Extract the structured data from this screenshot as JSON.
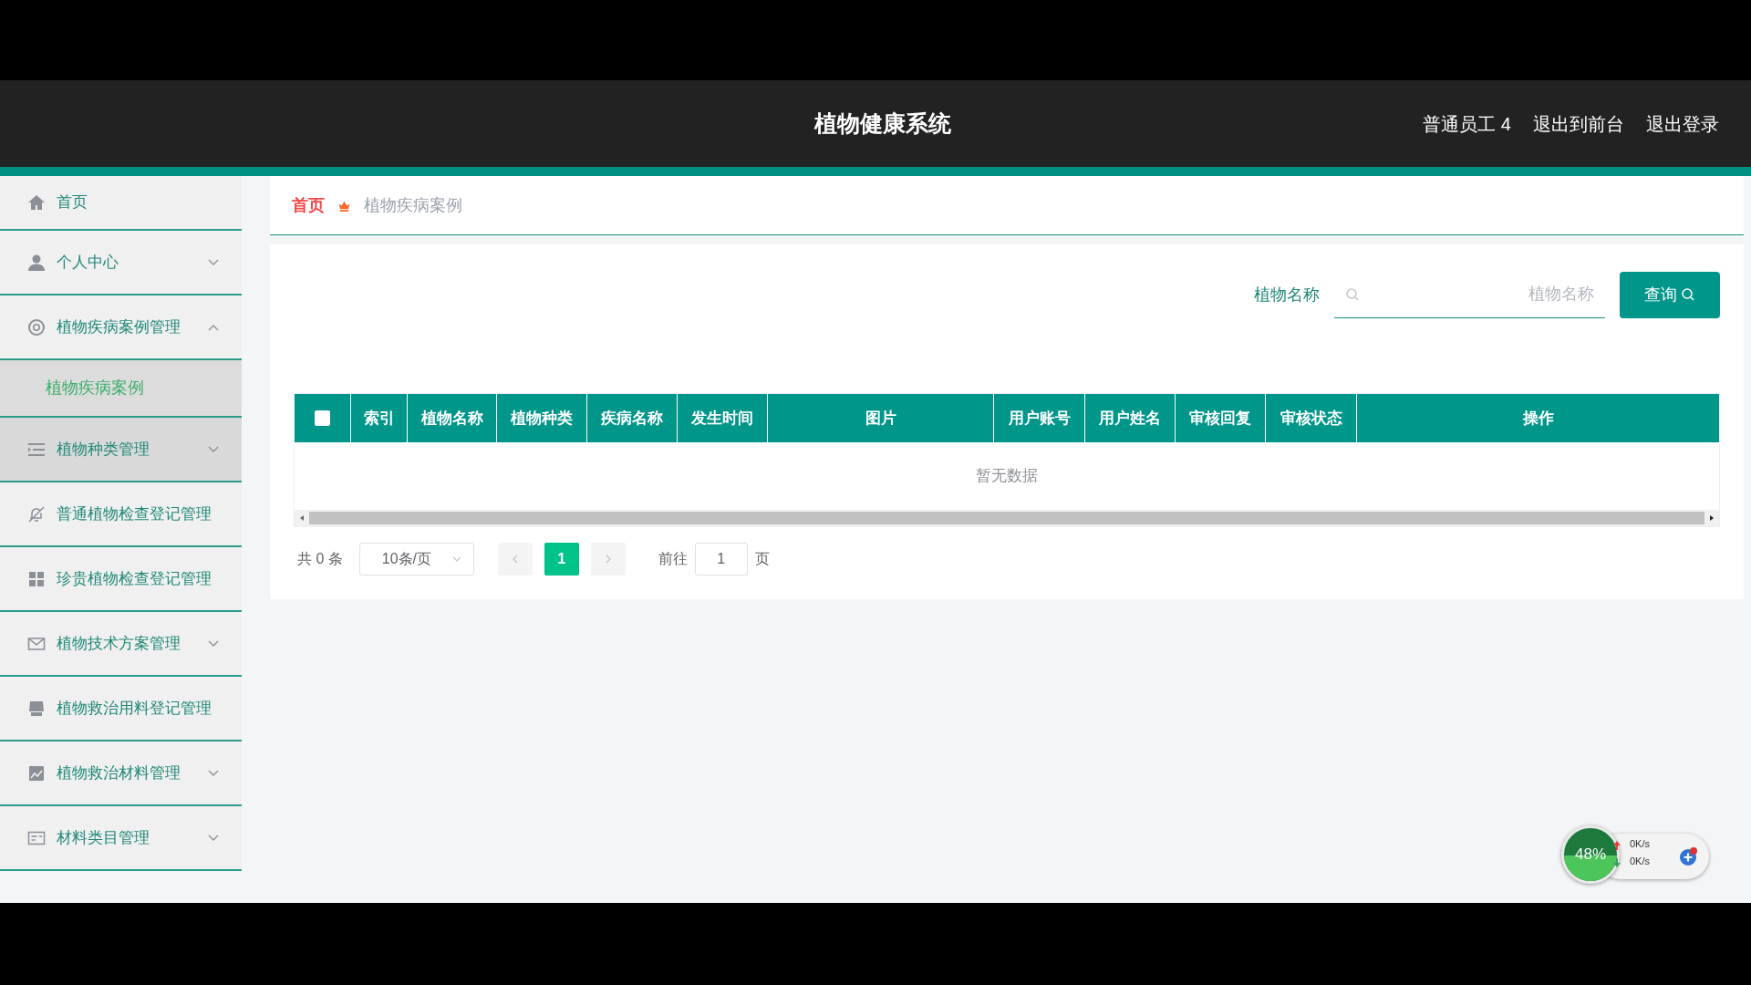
{
  "header": {
    "title": "植物健康系统",
    "user": "普通员工 4",
    "links": [
      "退出到前台",
      "退出登录"
    ]
  },
  "sidebar": {
    "items": [
      {
        "label": "首页",
        "highlighted": false
      },
      {
        "label": "个人中心",
        "highlighted": false,
        "expanded": false
      },
      {
        "label": "植物疾病案例管理",
        "highlighted": false,
        "expanded": true,
        "children": [
          {
            "label": "植物疾病案例",
            "selected": true
          }
        ]
      },
      {
        "label": "植物种类管理",
        "highlighted": true,
        "expanded": false
      },
      {
        "label": "普通植物检查登记管理",
        "highlighted": false
      },
      {
        "label": "珍贵植物检查登记管理",
        "highlighted": false
      },
      {
        "label": "植物技术方案管理",
        "highlighted": false,
        "expanded": false
      },
      {
        "label": "植物救治用料登记管理",
        "highlighted": false
      },
      {
        "label": "植物救治材料管理",
        "highlighted": false,
        "expanded": false
      },
      {
        "label": "材料类目管理",
        "highlighted": false,
        "expanded": false
      }
    ]
  },
  "breadcrumb": [
    "首页",
    "植物疾病案例"
  ],
  "search": {
    "label": "植物名称",
    "placeholder": "植物名称",
    "button": "查询"
  },
  "table": {
    "columns": [
      {
        "kind": "checkbox",
        "checked": false
      },
      {
        "kind": "text",
        "label": "索引"
      },
      {
        "kind": "text",
        "label": "植物名称"
      },
      {
        "kind": "text",
        "label": "植物种类"
      },
      {
        "kind": "text",
        "label": "疾病名称"
      },
      {
        "kind": "text",
        "label": "发生时间"
      },
      {
        "kind": "text",
        "label": "图片"
      },
      {
        "kind": "text",
        "label": "用户账号"
      },
      {
        "kind": "text",
        "label": "用户姓名"
      },
      {
        "kind": "text",
        "label": "审核回复"
      },
      {
        "kind": "text",
        "label": "审核状态"
      },
      {
        "kind": "text",
        "label": "操作"
      }
    ],
    "empty_text": "暂无数据"
  },
  "pagination": {
    "total": "共 0 条",
    "page_size": "10条/页",
    "pages": [
      {
        "label": "1",
        "selected": true
      }
    ],
    "goto_label": "前往",
    "goto_value": "1",
    "goto_suffix": "页"
  },
  "speed_widget": {
    "percent": "48%",
    "upload": "0K/s",
    "download": "0K/s"
  }
}
